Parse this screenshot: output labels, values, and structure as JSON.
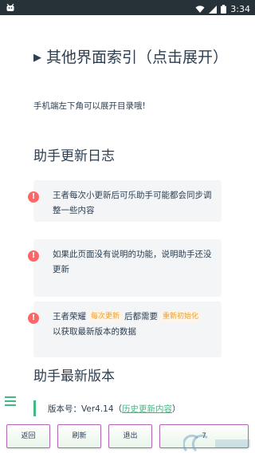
{
  "status_bar": {
    "app_icon": "android-debug-icon",
    "time": "3:34",
    "icons": [
      "wifi-icon",
      "signal-icon",
      "battery-icon"
    ]
  },
  "index": {
    "title": "其他界面索引（点击展开）",
    "arrow": "▶"
  },
  "mobile_hint": "手机端左下角可以展开目录哦!",
  "log_section": {
    "heading": "助手更新日志",
    "notices": [
      {
        "text": "王者每次小更新后可乐助手可能都会同步调整一些内容"
      },
      {
        "text": "如果此页面没有说明的功能，说明助手还没更新"
      },
      {
        "text_before": "王者荣耀",
        "tag1": "每次更新",
        "text_mid": "后都需要",
        "tag2": "重新初始化",
        "text_after": "以获取最新版本的数据"
      }
    ]
  },
  "version_section": {
    "heading": "助手最新版本",
    "label": "版本号：",
    "version": "Ver4.14",
    "link_open": "（",
    "link": "历史更新内容",
    "link_close": "）"
  },
  "buttons": {
    "back": "返回",
    "refresh": "刷新",
    "exit": "退出",
    "last": "7 "
  },
  "colors": {
    "accent": "#42b983",
    "notice_icon": "#ff6666",
    "tag_text": "#e6a23c",
    "status_bar": "#263238"
  }
}
